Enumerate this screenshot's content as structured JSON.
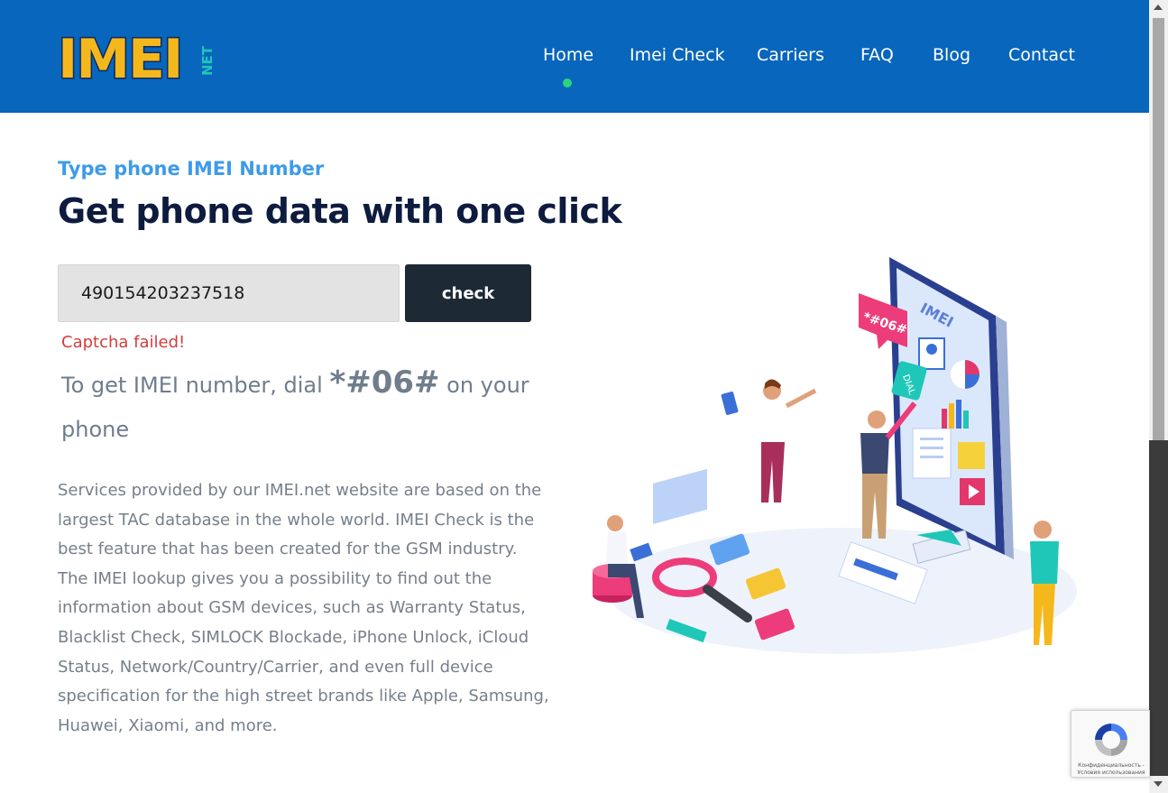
{
  "header": {
    "logo_text": "IMEI",
    "logo_suffix": "NET",
    "nav": [
      {
        "label": "Home",
        "active": true
      },
      {
        "label": "Imei Check",
        "active": false
      },
      {
        "label": "Carriers",
        "active": false
      },
      {
        "label": "FAQ",
        "active": false
      },
      {
        "label": "Blog",
        "active": false
      },
      {
        "label": "Contact",
        "active": false
      }
    ]
  },
  "main": {
    "subtitle": "Type phone IMEI Number",
    "title": "Get phone data with one click",
    "imei_input_value": "490154203237518",
    "check_button": "check",
    "captcha_error": "Captcha failed!",
    "dial_prefix": "To get IMEI number, dial",
    "dial_code": "*#06#",
    "dial_suffix": "on your phone",
    "description": "Services provided by our IMEI.net website are based on the largest TAC database in the whole world. IMEI Check is the best feature that has been created for the GSM industry. The IMEI lookup gives you a possibility to find out the information about GSM devices, such as Warranty Status, Blacklist Check, SIMLOCK Blockade, iPhone Unlock, iCloud Status, Network/Country/Carrier, and even full device specification for the high street brands like Apple, Samsung, Huawei, Xiaomi, and more."
  },
  "illustration": {
    "phone_brand": "IMEI",
    "bubble_code": "*#06#",
    "dial_tag": "DIAL"
  },
  "recaptcha": {
    "line1": "Конфиденциальность -",
    "line2": "Условия использования"
  },
  "colors": {
    "header_bg": "#0866bd",
    "accent_blue": "#3d9be9",
    "title_navy": "#0d1b3e",
    "button_dark": "#1d2a35",
    "error_red": "#d43d3d",
    "active_dot": "#2ed47a",
    "logo_yellow": "#f5b81c"
  }
}
